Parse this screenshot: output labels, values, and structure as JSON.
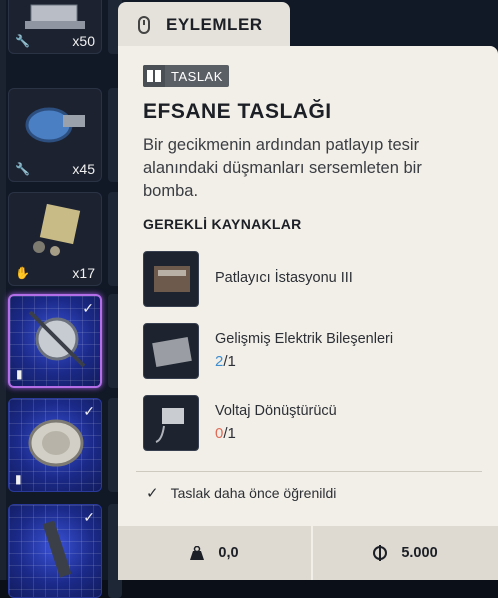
{
  "header": {
    "title": "EYLEMLER",
    "icon": "mouse-icon"
  },
  "inventory": [
    {
      "count": "x50",
      "icon": "wrench-icon"
    },
    {
      "count": "x45",
      "icon": "wrench-icon"
    },
    {
      "count": "x17",
      "icon": "hand-icon"
    },
    {
      "icon": "blueprint-icon",
      "checked": true,
      "selected": true
    },
    {
      "icon": "blueprint-icon",
      "checked": true
    },
    {
      "icon": "blueprint-icon",
      "checked": true
    }
  ],
  "panel": {
    "badge": "TASLAK",
    "title": "EFSANE TASLAĞI",
    "description": "Bir gecikmenin ardından patlayıp tesir alanındaki düşmanları sersemleten bir bomba.",
    "section_title": "GEREKLİ KAYNAKLAR",
    "resources": [
      {
        "name": "Patlayıcı İstasyonu III",
        "have": "",
        "need": ""
      },
      {
        "name": "Gelişmiş Elektrik Bileşenleri",
        "have": "2",
        "need": "/1"
      },
      {
        "name": "Voltaj Dönüştürücü",
        "have": "0",
        "need": "/1"
      }
    ],
    "learned": "Taslak daha önce öğrenildi",
    "footer": {
      "weight": "0,0",
      "price": "5.000"
    }
  },
  "colors": {
    "accent_blue": "#3e8ed0",
    "accent_red": "#e06a55",
    "selected_border": "#b36ee8"
  }
}
